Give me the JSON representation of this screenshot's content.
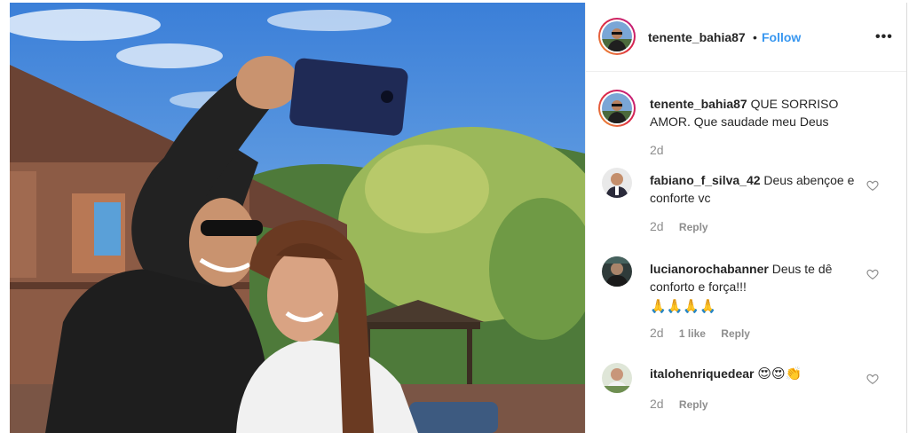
{
  "post": {
    "author": "tenente_bahia87",
    "separator": "•",
    "follow_label": "Follow",
    "more_label": "•••"
  },
  "caption": {
    "username": "tenente_bahia87",
    "text": "QUE SORRISO AMOR. Que saudade meu Deus",
    "time": "2d"
  },
  "comments": [
    {
      "username": "fabiano_f_silva_42",
      "text": "Deus abençoe e conforte vc",
      "time": "2d",
      "likes": "",
      "reply": "Reply"
    },
    {
      "username": "lucianorochabanner",
      "text": "Deus te dê conforto e força!!!",
      "emojis": [
        "folded-hands",
        "folded-hands",
        "folded-hands",
        "folded-hands"
      ],
      "time": "2d",
      "likes": "1 like",
      "reply": "Reply"
    },
    {
      "username": "italohenriquedear",
      "text": "",
      "emojis": [
        "heart-eyes",
        "heart-eyes",
        "clapping-hands"
      ],
      "time": "2d",
      "likes": "",
      "reply": "Reply"
    }
  ],
  "colors": {
    "follow": "#3897f0",
    "meta": "#8e8e8e",
    "text": "#262626"
  }
}
